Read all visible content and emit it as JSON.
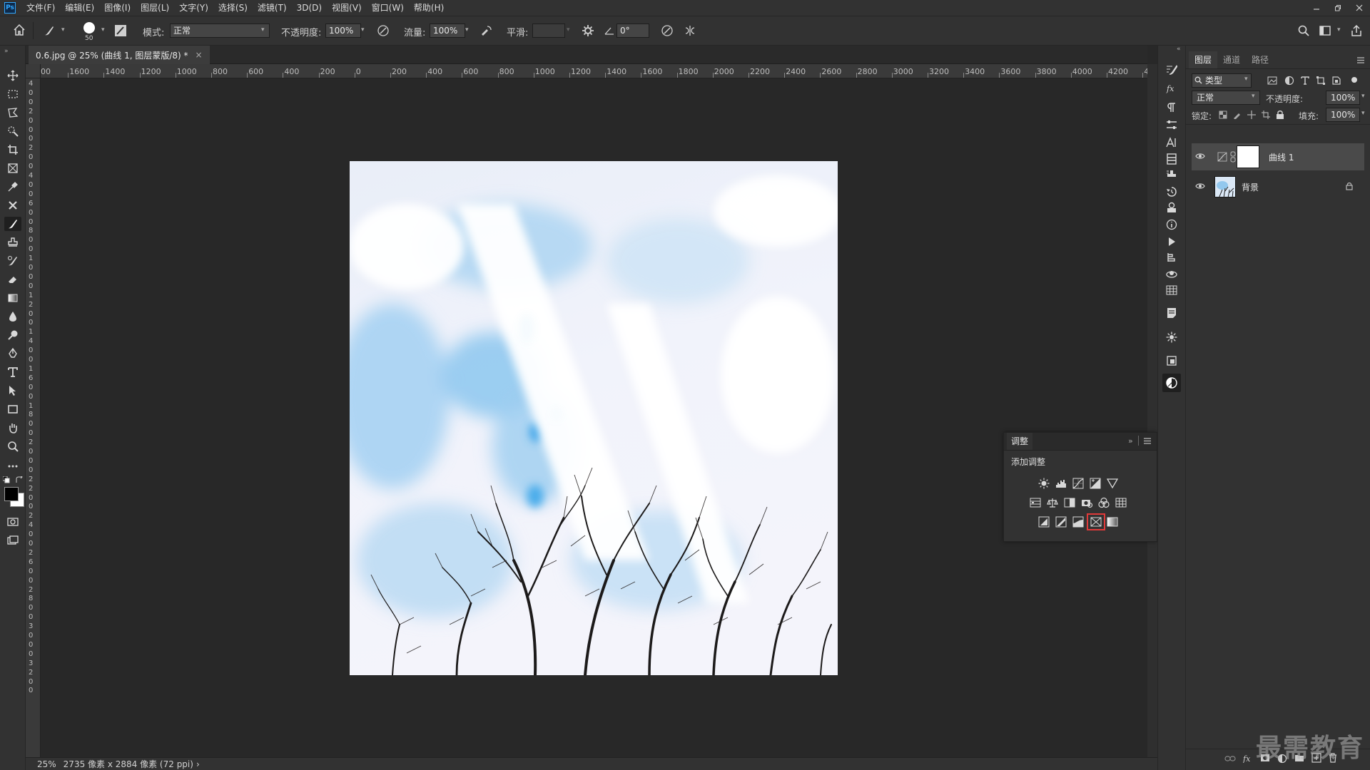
{
  "app": {
    "logo": "Ps"
  },
  "menu": [
    "文件(F)",
    "编辑(E)",
    "图像(I)",
    "图层(L)",
    "文字(Y)",
    "选择(S)",
    "滤镜(T)",
    "3D(D)",
    "视图(V)",
    "窗口(W)",
    "帮助(H)"
  ],
  "options": {
    "brush_size": "50",
    "mode_label": "模式:",
    "mode_value": "正常",
    "opacity_label": "不透明度:",
    "opacity_value": "100%",
    "flow_label": "流量:",
    "flow_value": "100%",
    "smooth_label": "平滑:",
    "smooth_value": "",
    "angle_value": "0°"
  },
  "document": {
    "tab_title": "0.6.jpg @ 25% (曲线 1, 图层蒙版/8) *",
    "close": "×",
    "ruler_h": [
      "00",
      "1600",
      "1400",
      "1200",
      "1000",
      "800",
      "600",
      "400",
      "200",
      "0",
      "200",
      "400",
      "600",
      "800",
      "1000",
      "1200",
      "1400",
      "1600",
      "1800",
      "2000",
      "2200",
      "2400",
      "2600",
      "2800",
      "3000",
      "3200",
      "3400",
      "3600",
      "3800",
      "4000",
      "4200",
      "44"
    ],
    "ruler_v": [
      "4",
      "0",
      "0",
      "2",
      "0",
      "0",
      "0",
      "2",
      "0",
      "0",
      "4",
      "0",
      "0",
      "6",
      "0",
      "0",
      "8",
      "0",
      "0",
      "1",
      "0",
      "0",
      "0",
      "1",
      "2",
      "0",
      "0",
      "1",
      "4",
      "0",
      "0",
      "1",
      "6",
      "0",
      "0",
      "1",
      "8",
      "0",
      "0",
      "2",
      "0",
      "0",
      "0",
      "2",
      "2",
      "0",
      "0",
      "2",
      "4",
      "0",
      "0",
      "2",
      "6",
      "0",
      "0",
      "2",
      "8",
      "0",
      "0",
      "3",
      "0",
      "0",
      "0",
      "3",
      "2",
      "0",
      "0"
    ]
  },
  "status": {
    "zoom": "25%",
    "info": "2735 像素 x 2884 像素 (72 ppi)",
    "arrow": "›"
  },
  "adjustments": {
    "title": "调整",
    "subtitle": "添加调整",
    "row1": [
      "brightness-icon",
      "levels-icon",
      "curves-icon",
      "exposure-icon",
      "vibrance-icon"
    ],
    "row2": [
      "hue-saturation-icon",
      "color-balance-icon",
      "black-white-icon",
      "photo-filter-icon",
      "channel-mixer-icon",
      "color-lookup-icon"
    ],
    "row3": [
      "invert-icon",
      "posterize-icon",
      "threshold-icon",
      "gradient-map-icon",
      "selective-color-icon"
    ],
    "highlight_color": "#e03a3a"
  },
  "layers_panel": {
    "tabs": [
      "图层",
      "通道",
      "路径"
    ],
    "filter_value": "类型",
    "blend_value": "正常",
    "opacity_label": "不透明度:",
    "opacity_value": "100%",
    "lock_label": "锁定:",
    "fill_label": "填充:",
    "fill_value": "100%",
    "layers": [
      {
        "name": "曲线 1",
        "selected": true
      },
      {
        "name": "背景",
        "selected": false
      }
    ]
  },
  "watermark": "最需教育"
}
